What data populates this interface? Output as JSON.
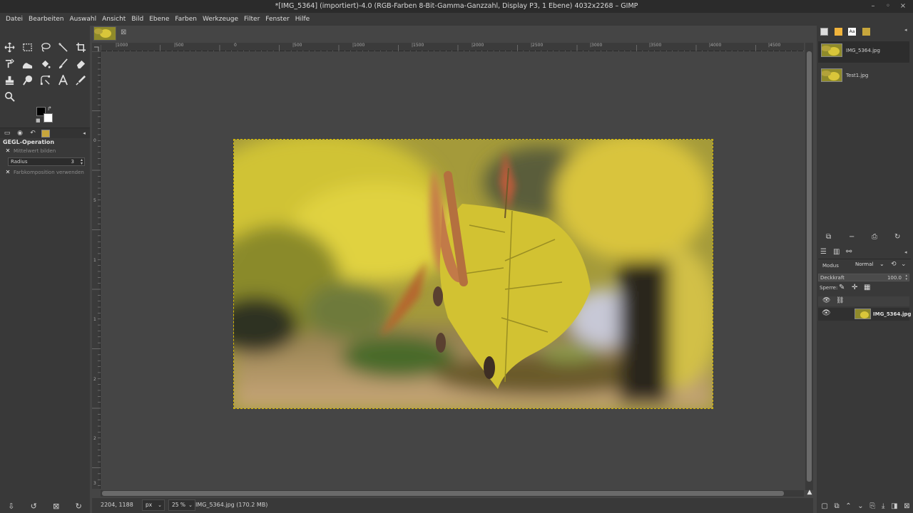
{
  "window": {
    "title": "*[IMG_5364] (importiert)-4.0 (RGB-Farben 8-Bit-Gamma-Ganzzahl, Display P3, 1 Ebene) 4032x2268 – GIMP",
    "minimize": "–",
    "maximize": "◦",
    "close": "×"
  },
  "menu": [
    "Datei",
    "Bearbeiten",
    "Auswahl",
    "Ansicht",
    "Bild",
    "Ebene",
    "Farben",
    "Werkzeuge",
    "Filter",
    "Fenster",
    "Hilfe"
  ],
  "tools": [
    "move-tool",
    "rect-select-tool",
    "free-select-tool",
    "fuzzy-select-tool",
    "crop-tool",
    "transform-tool",
    "warp-tool",
    "bucket-fill-tool",
    "paintbrush-tool",
    "eraser-tool",
    "clone-tool",
    "smudge-tool",
    "paths-tool",
    "text-tool",
    "color-picker-tool",
    "zoom-tool"
  ],
  "tool_options": {
    "title": "GEGL-Operation",
    "option1": "Mittelwert bilden",
    "radius_label": "Radius",
    "radius_value": "3",
    "option2": "Farbkomposition verwenden"
  },
  "colors": {
    "foreground": "#000000",
    "background": "#ffffff",
    "selection": "#d4b800"
  },
  "rulers": {
    "horizontal": [
      "|1000",
      "|500",
      "0",
      "|500",
      "|1000",
      "|1500",
      "|2000",
      "|2500",
      "|3000",
      "|3500",
      "|4000",
      "|4500"
    ],
    "vertical": [
      "0",
      "5",
      "1",
      "1",
      "2",
      "2",
      "3"
    ]
  },
  "status": {
    "coords": "2204, 1188",
    "unit": "px",
    "zoom": "25 %",
    "message": "IMG_5364.jpg (170.2 MB)"
  },
  "images_panel": {
    "items": [
      {
        "name": "IMG_5364.jpg"
      },
      {
        "name": "Test1.jpg"
      }
    ]
  },
  "layers_panel": {
    "mode_label": "Modus",
    "mode_value": "Normal",
    "opacity_label": "Deckkraft",
    "opacity_value": "100.0",
    "lock_label": "Sperre:",
    "layer_name": "IMG_5364.jpg"
  }
}
